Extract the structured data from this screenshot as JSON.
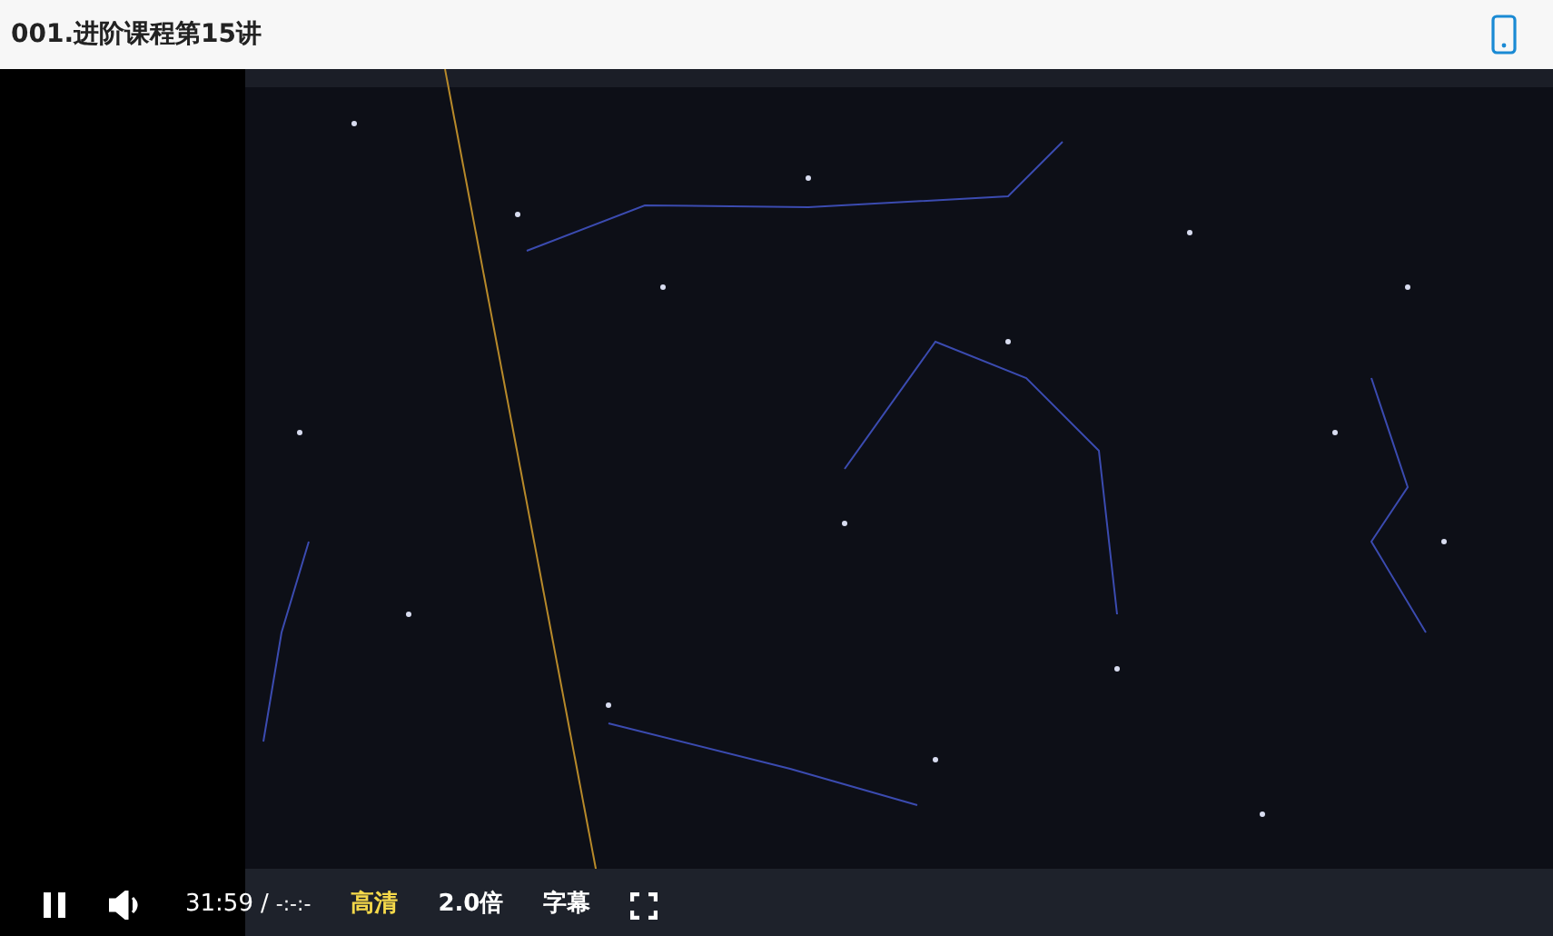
{
  "title": "001.进阶课程第15讲",
  "player": {
    "playing": true,
    "current_time": "31:59",
    "separator": "/",
    "duration": "-:-:-",
    "quality": {
      "label": "高清",
      "selected": true
    },
    "speed": "2.0倍",
    "subtitles": "字幕"
  }
}
